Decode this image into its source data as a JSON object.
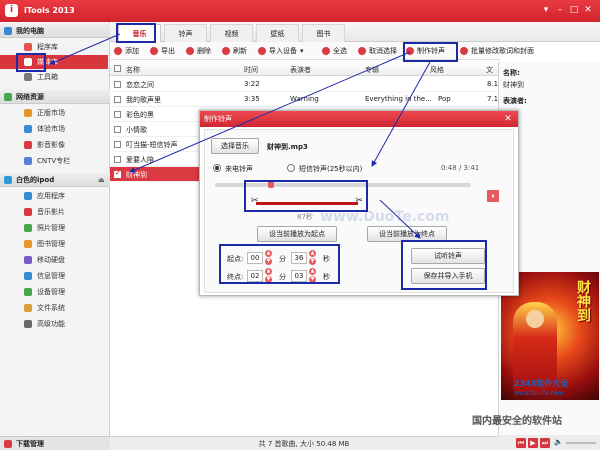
{
  "app": {
    "title": "iTools 2013"
  },
  "window_buttons": [
    "▾",
    "–",
    "□",
    "✕"
  ],
  "sidebar": {
    "groups": [
      {
        "label": "我的电脑",
        "items": [
          "程序库",
          "媒体库",
          "工具箱"
        ]
      },
      {
        "label": "网络资源",
        "items": [
          "正版市场",
          "体验市场",
          "影音影像",
          "CNTV专栏"
        ]
      },
      {
        "label": "白色的ipod",
        "items": [
          "应用程序",
          "音乐影片",
          "照片管理",
          "图书管理",
          "移动硬盘",
          "信息管理",
          "设备管理",
          "文件系统",
          "高级功能"
        ]
      }
    ],
    "bottom": "下载管理",
    "colors": [
      "#3a8bd6",
      "#e5534b",
      "#7a7a7a",
      "#46a84a",
      "#e2962c",
      "#3a8bd6",
      "#d83a40",
      "#5b7fd6",
      "#e2962c",
      "#7c5cc4",
      "#3a8bd6",
      "#46a84a",
      "#d8a03a",
      "#2f9ad8",
      "#6a6a6a",
      "#d83a40"
    ]
  },
  "tabs": [
    "音乐",
    "铃声",
    "视频",
    "壁纸",
    "图书"
  ],
  "toolbar": [
    "添加",
    "导出",
    "删除",
    "刷新",
    "导入设备",
    "全选",
    "取消选择",
    "制作铃声",
    "批量修改歌词和封面"
  ],
  "list": {
    "headers": [
      "名称",
      "时间",
      "表演者",
      "专辑",
      "风格",
      "文"
    ],
    "rows": [
      {
        "name": "恋恋之间",
        "time": "3:22",
        "artist": "",
        "album": "",
        "genre": "",
        "size": "8.1"
      },
      {
        "name": "我的歌声里",
        "time": "3:35",
        "artist": "Warning",
        "album": "Everything in the...",
        "genre": "Pop",
        "size": "7.1"
      },
      {
        "name": "彩色的黑",
        "time": "",
        "artist": "",
        "album": "",
        "genre": "",
        "size": ""
      },
      {
        "name": "小情歌",
        "time": "",
        "artist": "",
        "album": "",
        "genre": "",
        "size": ""
      },
      {
        "name": "叮当猫-短信铃声",
        "time": "",
        "artist": "",
        "album": "",
        "genre": "",
        "size": ""
      },
      {
        "name": "爱要人陪",
        "time": "",
        "artist": "",
        "album": "",
        "genre": "",
        "size": ""
      },
      {
        "name": "财神到",
        "time": "",
        "artist": "",
        "album": "",
        "genre": "",
        "size": ""
      }
    ]
  },
  "info": {
    "name_label": "名称:",
    "name_value": "财神到",
    "artist_label": "表演者:",
    "art_text": "财神到"
  },
  "dialog": {
    "title": "制作铃声",
    "choose_label": "选择音乐",
    "file": "财神到.mp3",
    "mode_call": "来电铃声",
    "mode_sms": "短信铃声(25秒以内)",
    "time_display": "0:48 / 3:41",
    "duration": "87秒",
    "set_start": "设当前播放为起点",
    "set_end": "设当前播放为终点",
    "start_label": "起点:",
    "end_label": "终点:",
    "start_min": "00",
    "start_sec": "36",
    "end_min": "02",
    "end_sec": "03",
    "unit_min": "分",
    "unit_sec": "秒",
    "preview": "试听铃声",
    "save": "保存并导入手机",
    "progress": 0.22,
    "sel_start": 0.16,
    "sel_end": 0.56
  },
  "status": "共 7 首歌曲, 大小 50.48 MB",
  "watermarks": {
    "site1": "2345软件大全",
    "site2": "www.DuoTe.com",
    "slogan": "国内最安全的软件站",
    "wm_dialog": "www.DuoTe.com"
  }
}
